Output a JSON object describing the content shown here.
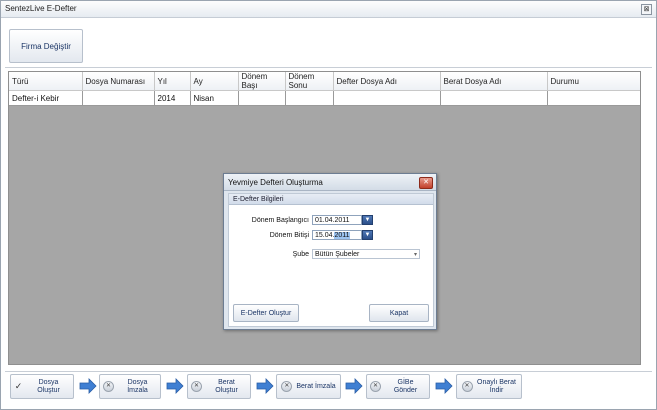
{
  "window": {
    "title": "SentezLive E-Defter",
    "close_glyph": "⊠"
  },
  "header": {
    "firma_button": "Firma Değiştir"
  },
  "grid": {
    "columns": [
      "Türü",
      "Dosya Numarası",
      "Yıl",
      "Ay",
      "Dönem Başı",
      "Dönem Sonu",
      "Defter Dosya Adı",
      "Berat Dosya Adı",
      "Durumu"
    ],
    "rows": [
      [
        "Defter-i Kebir",
        "",
        "2014",
        "Nisan",
        "",
        "",
        "",
        "",
        ""
      ]
    ]
  },
  "dialog": {
    "title": "Yevmiye Defteri Oluşturma",
    "close_glyph": "✕",
    "group_title": "E-Defter Bilgileri",
    "start_label": "Dönem Başlangıcı",
    "start_value": "01.04.2011",
    "end_label": "Dönem Bitişi",
    "end_value_prefix": "15.04.",
    "end_value_selected": "2011",
    "branch_label": "Şube",
    "branch_value": "Bütün Şubeler",
    "create_button": "E-Defter Oluştur",
    "close_button": "Kapat"
  },
  "toolbar": {
    "steps": [
      {
        "label": "Dosya Oluştur",
        "icon": "check-icon",
        "glyph": "✓"
      },
      {
        "label": "Dosya İmzala",
        "icon": "x-circle-icon",
        "glyph": "✕"
      },
      {
        "label": "Berat Oluştur",
        "icon": "x-circle-icon",
        "glyph": "✕"
      },
      {
        "label": "Berat İmzala",
        "icon": "x-circle-icon",
        "glyph": "✕"
      },
      {
        "label": "GİBe Gönder",
        "icon": "x-circle-icon",
        "glyph": "✕"
      },
      {
        "label": "Onaylı Berat İndir",
        "icon": "x-circle-icon",
        "glyph": "✕"
      }
    ],
    "arrow_color": "#3f7fd3"
  }
}
